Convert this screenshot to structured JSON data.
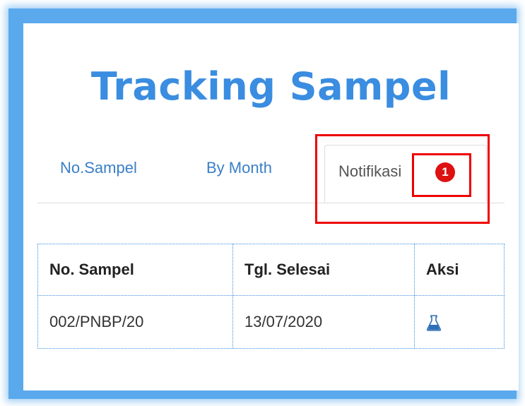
{
  "page": {
    "title": "Tracking Sampel"
  },
  "tabs": [
    {
      "label": "No.Sampel"
    },
    {
      "label": "By Month"
    },
    {
      "label": "Notifikasi",
      "badge": "1",
      "active": true
    }
  ],
  "table": {
    "headers": [
      "No. Sampel",
      "Tgl. Selesai",
      "Aksi"
    ],
    "rows": [
      {
        "no_sampel": "002/PNBP/20",
        "tgl_selesai": "13/07/2020",
        "aksi_icon": "flask-icon"
      }
    ]
  },
  "colors": {
    "title": "#3a8de0",
    "tab_link": "#3a7fc6",
    "badge": "#dd1111",
    "highlight": "#ee0000",
    "frame": "#5aa9ec"
  }
}
